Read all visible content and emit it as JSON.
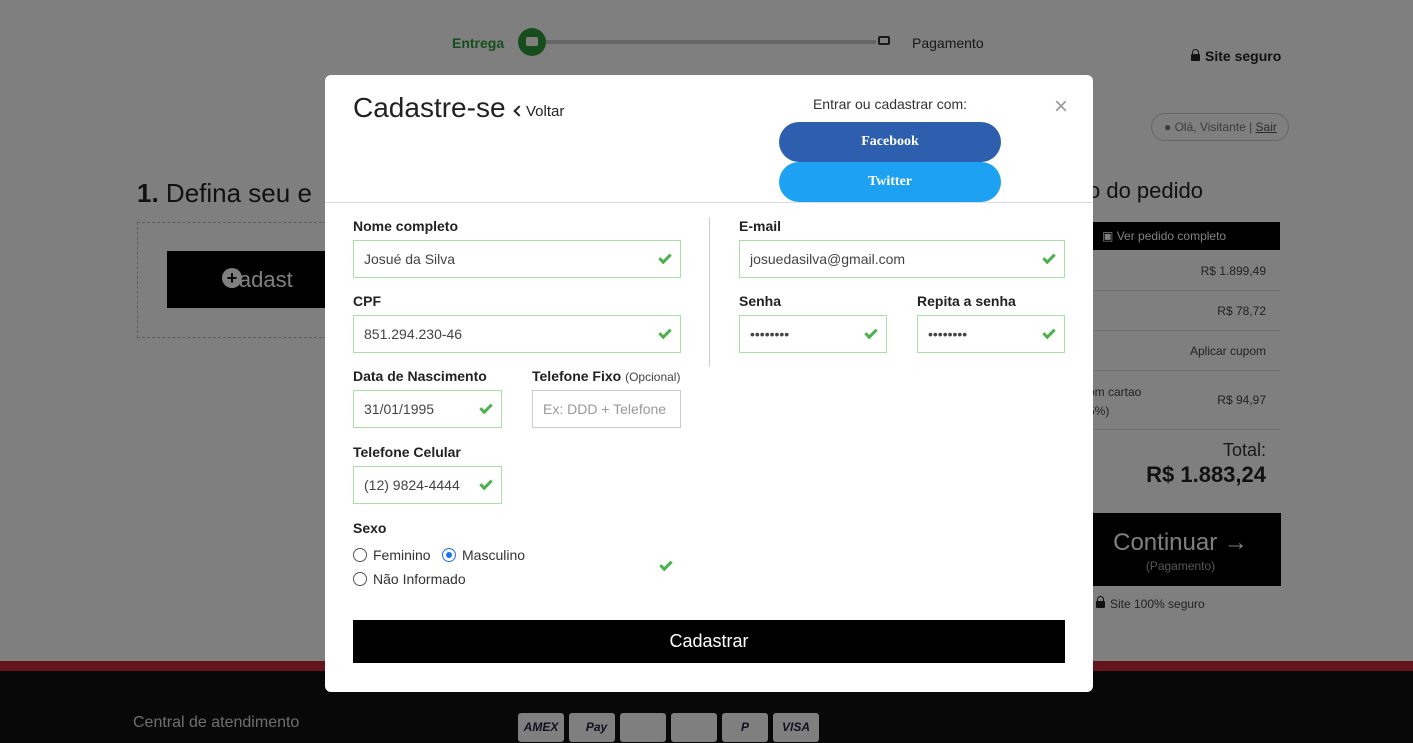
{
  "progress": {
    "step1": "Entrega",
    "step2": "Pagamento"
  },
  "header": {
    "secure": "Site seguro",
    "greeting": "Olá, Visitante | ",
    "logout": "Sair"
  },
  "page": {
    "step_number": "1.",
    "step_title": "Defina seu e",
    "add_address": "Cadast",
    "summary_title": "o do pedido"
  },
  "summary": {
    "view_full": "Ver pedido completo",
    "rows": [
      {
        "label": "",
        "value": "R$ 1.899,49"
      },
      {
        "label": "",
        "value": "R$ 78,72"
      },
      {
        "label": "",
        "value": "Aplicar cupom"
      },
      {
        "label": "om cartao\n5%)",
        "value": "R$ 94,97"
      }
    ],
    "total_label": "Total:",
    "total_value": "R$ 1.883,24",
    "continue_label": "Continuar →",
    "continue_sub": "(Pagamento)",
    "secure_note": "Site 100% seguro"
  },
  "footer": {
    "link": "Central de atendimento",
    "payments": [
      "AMEX",
      "Pay",
      "",
      "",
      "P",
      "VISA"
    ]
  },
  "modal": {
    "title": "Cadastre-se",
    "back": "Voltar",
    "social_label": "Entrar ou cadastrar com:",
    "facebook": "Facebook",
    "twitter": "Twitter",
    "close": "×",
    "fields": {
      "name": {
        "label": "Nome completo",
        "value": "Josué da Silva"
      },
      "cpf": {
        "label": "CPF",
        "value": "851.294.230-46"
      },
      "birth": {
        "label": "Data de Nascimento",
        "value": "31/01/1995"
      },
      "phone": {
        "label": "Telefone Fixo",
        "optional": "(Opcional)",
        "placeholder": "Ex: DDD + Telefone"
      },
      "mobile": {
        "label": "Telefone Celular",
        "value": "(12) 9824-4444"
      },
      "email": {
        "label": "E-mail",
        "value": "josuedasilva@gmail.com"
      },
      "password": {
        "label": "Senha",
        "value": "••••••••"
      },
      "password_repeat": {
        "label": "Repita a senha",
        "value": "••••••••"
      }
    },
    "gender": {
      "label": "Sexo",
      "options": [
        "Feminino",
        "Masculino",
        "Não Informado"
      ],
      "selected": "Masculino"
    },
    "submit": "Cadastrar"
  }
}
